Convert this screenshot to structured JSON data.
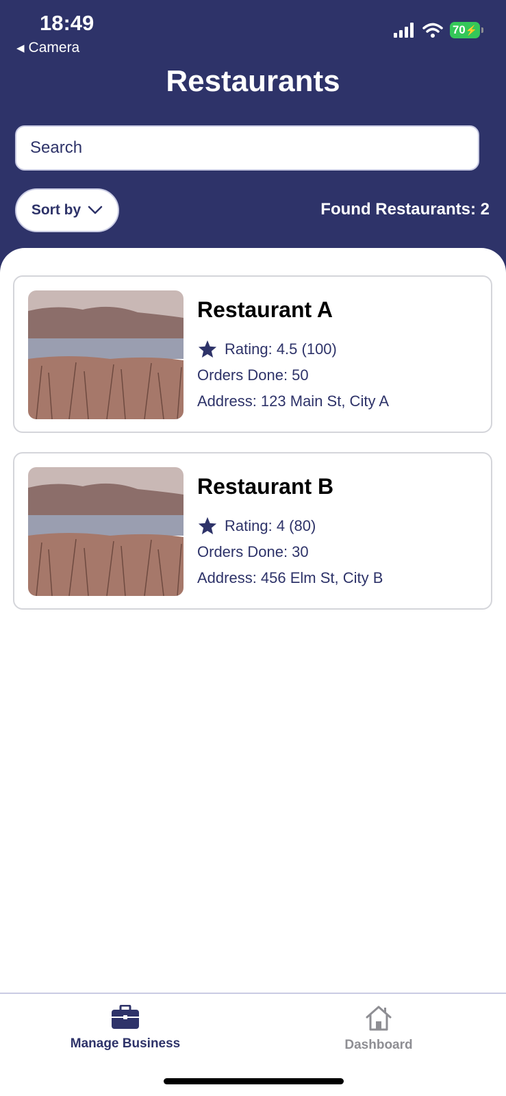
{
  "status_bar": {
    "time": "18:49",
    "back_app": "Camera",
    "battery": "70"
  },
  "header": {
    "title": "Restaurants",
    "search_placeholder": "Search",
    "sort_label": "Sort by",
    "found_label": "Found Restaurants: 2"
  },
  "restaurants": [
    {
      "name": "Restaurant A",
      "rating": "Rating: 4.5 (100)",
      "orders": "Orders Done: 50",
      "address": "Address: 123 Main St, City A"
    },
    {
      "name": "Restaurant B",
      "rating": "Rating: 4 (80)",
      "orders": "Orders Done: 30",
      "address": "Address: 456 Elm St, City B"
    }
  ],
  "tabbar": {
    "tabs": [
      {
        "label": "Manage Business",
        "icon": "briefcase-icon",
        "active": true
      },
      {
        "label": "Dashboard",
        "icon": "home-icon",
        "active": false
      }
    ]
  },
  "colors": {
    "primary": "#2e3369",
    "battery": "#34c759",
    "inactive_tab": "#8e8e93",
    "card_border": "#d4d5da"
  }
}
